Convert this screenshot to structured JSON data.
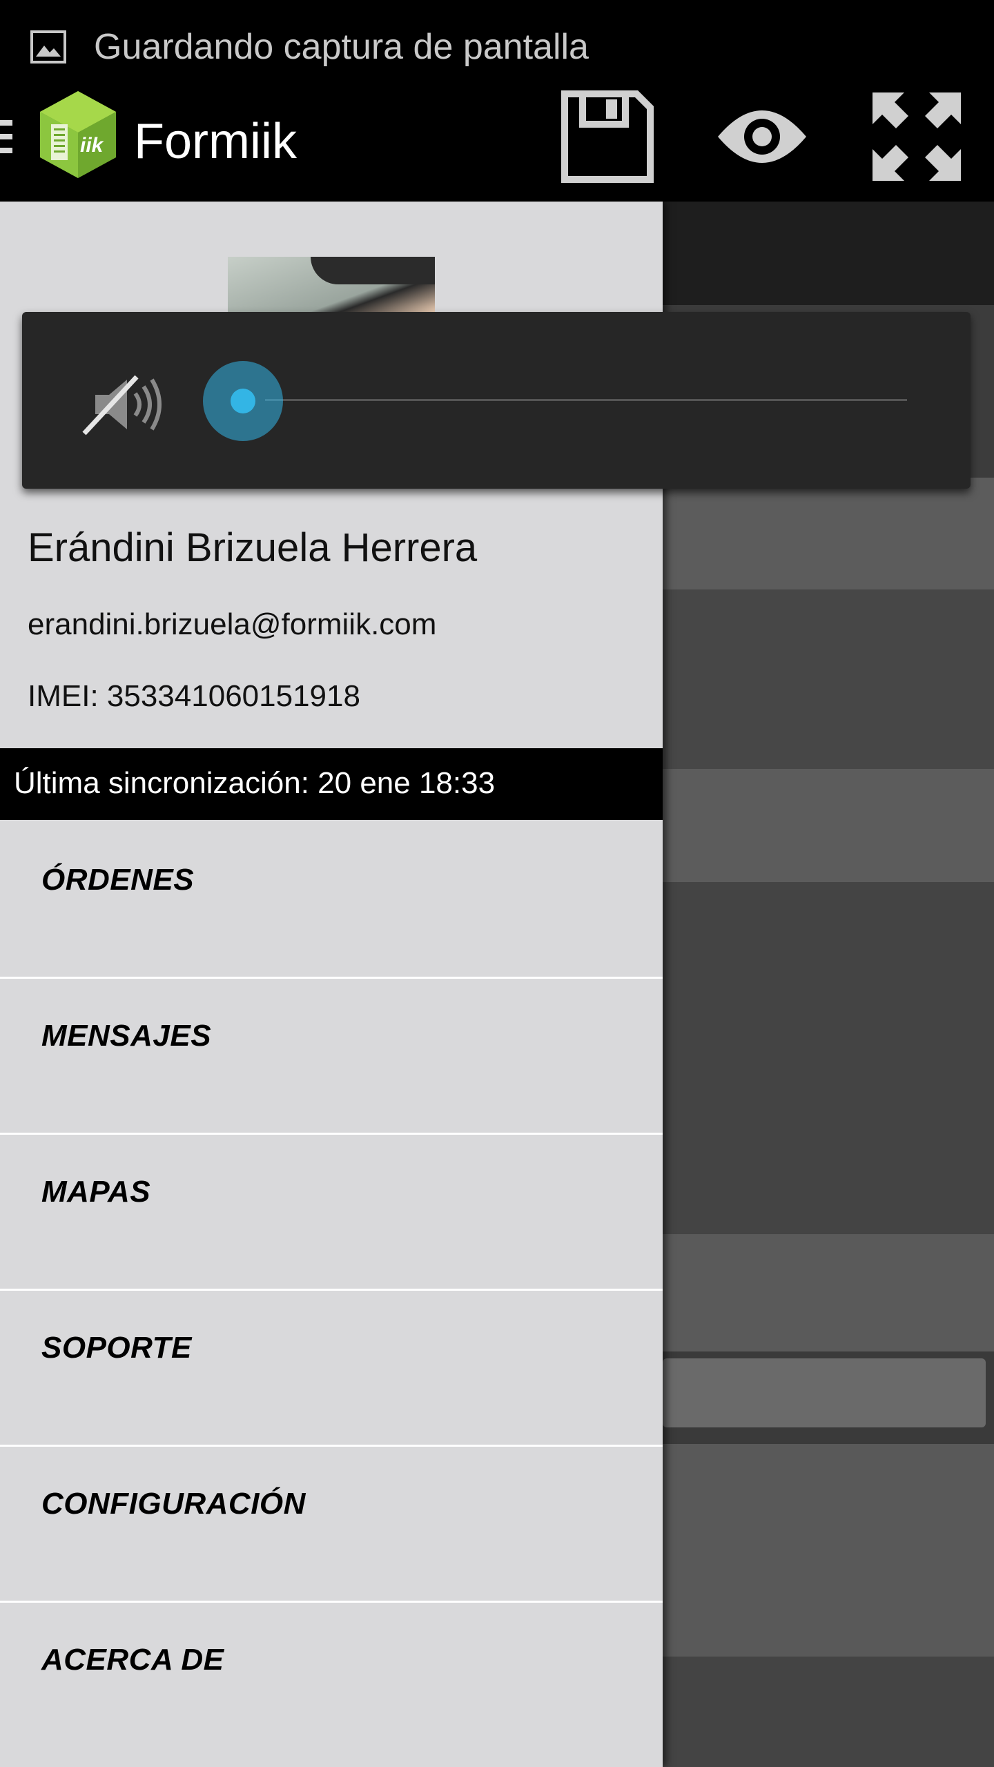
{
  "status_bar": {
    "notification_text": "Guardando captura de pantalla",
    "notification_icon": "image-icon"
  },
  "action_bar": {
    "app_title": "Formiik",
    "logo_text": "iik",
    "actions": [
      {
        "name": "save",
        "icon": "floppy-disk-icon"
      },
      {
        "name": "preview",
        "icon": "eye-icon"
      },
      {
        "name": "fullscreen",
        "icon": "expand-arrows-icon"
      }
    ]
  },
  "drawer": {
    "user": {
      "name": "Erándini Brizuela Herrera",
      "email": "erandini.brizuela@formiik.com",
      "imei": "IMEI: 353341060151918"
    },
    "last_sync": "Última sincronización: 20 ene 18:33",
    "menu": [
      {
        "label": "ÓRDENES"
      },
      {
        "label": "MENSAJES"
      },
      {
        "label": "MAPAS"
      },
      {
        "label": "SOPORTE"
      },
      {
        "label": "CONFIGURACIÓN"
      },
      {
        "label": "ACERCA DE"
      }
    ]
  },
  "volume_panel": {
    "muted": true,
    "level": 0.0,
    "accent_color": "#33b5e5"
  },
  "colors": {
    "drawer_bg": "#d9d9db",
    "accent": "#33b5e5",
    "logo_green": "#8cc63f"
  }
}
